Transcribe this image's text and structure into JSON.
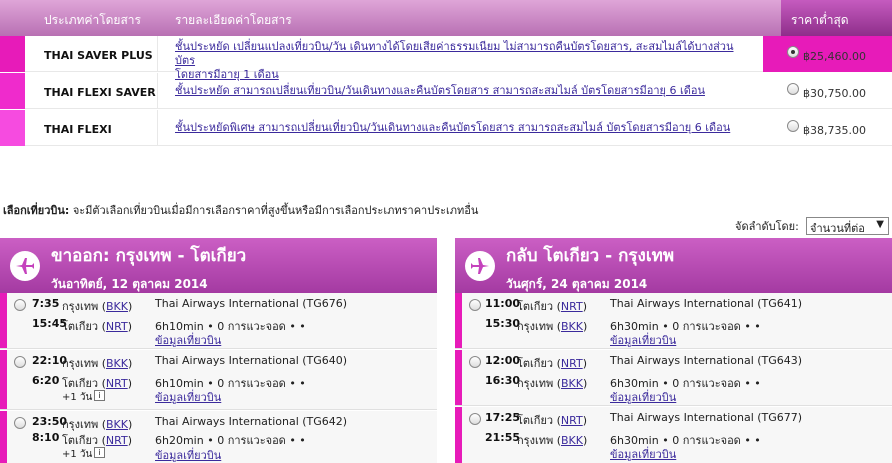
{
  "fare_table": {
    "header": {
      "type_label": "ประเภทค่าโดยสาร",
      "detail_label": "รายละเอียดค่าโดยสาร",
      "price_label": "ราคาต่ำสุด"
    },
    "rows": [
      {
        "name": "THAI SAVER PLUS",
        "desc_line1": "ชั้นประหยัด เปลี่ยนแปลงเที่ยวบิน/วัน เดินทางได้โดยเสียค่าธรรมเนียม ไม่สามารถคืนบัตรโดยสาร, สะสมไมล์ได้บางส่วน บัตร",
        "desc_line2": "โดยสารมีอายุ 1 เดือน",
        "price": "฿25,460.00",
        "selected": true,
        "bar_color": "#e71bb9"
      },
      {
        "name": "THAI FLEXI SAVER",
        "desc_line1": "ชั้นประหยัด สามารถเปลี่ยนเที่ยวบิน/วันเดินทางและคืนบัตรโดยสาร สามารถสะสมไมล์ บัตรโดยสารมีอายุ 6 เดือน",
        "desc_line2": "",
        "price": "฿30,750.00",
        "selected": false,
        "bar_color": "#ef2bcc"
      },
      {
        "name": "THAI FLEXI",
        "desc_line1": "ชั้นประหยัดพิเศษ สามารถเปลี่ยนเที่ยวบิน/วันเดินทางและคืนบัตรโดยสาร สามารถสะสมไมล์ บัตรโดยสารมีอายุ 6 เดือน",
        "desc_line2": "",
        "price": "฿38,735.00",
        "selected": false,
        "bar_color": "#f64be0"
      }
    ]
  },
  "select_flight": {
    "label": "เลือกเที่ยวบิน:",
    "note": "จะมีตัวเลือกเที่ยวบินเมื่อมีการเลือกราคาที่สูงขึ้นหรือมีการเลือกประเภทราคาประเภทอื่น",
    "sort_label": "จัดลำดับโดย:",
    "sort_value": "จำนวนที่ต่อ"
  },
  "outbound": {
    "title": "ขาออก: กรุงเทพ - โตเกียว",
    "date": "วันอาทิตย์, 12 ตุลาคม 2014",
    "flights": [
      {
        "dep_time": "7:35",
        "dep_city": "กรุงเทพ",
        "dep_code": "BKK",
        "arr_time": "15:45",
        "arr_city": "โตเกียว",
        "arr_code": "NRT",
        "airline": "Thai Airways International (TG676)",
        "duration": "6h10min",
        "stops": "0 การแวะจอด",
        "detail": "ข้อมูลเที่ยวบิน",
        "plus_day": ""
      },
      {
        "dep_time": "22:10",
        "dep_city": "กรุงเทพ",
        "dep_code": "BKK",
        "arr_time": "6:20",
        "arr_city": "โตเกียว",
        "arr_code": "NRT",
        "airline": "Thai Airways International (TG640)",
        "duration": "6h10min",
        "stops": "0 การแวะจอด",
        "detail": "ข้อมูลเที่ยวบิน",
        "plus_day": "+1 วัน"
      },
      {
        "dep_time": "23:50",
        "dep_city": "กรุงเทพ",
        "dep_code": "BKK",
        "arr_time": "8:10",
        "arr_city": "โตเกียว",
        "arr_code": "NRT",
        "airline": "Thai Airways International (TG642)",
        "duration": "6h20min",
        "stops": "0 การแวะจอด",
        "detail": "ข้อมูลเที่ยวบิน",
        "plus_day": "+1 วัน"
      }
    ]
  },
  "return": {
    "title": "กลับ โตเกียว - กรุงเทพ",
    "date": "วันศุกร์, 24 ตุลาคม 2014",
    "flights": [
      {
        "dep_time": "11:00",
        "dep_city": "โตเกียว",
        "dep_code": "NRT",
        "arr_time": "15:30",
        "arr_city": "กรุงเทพ",
        "arr_code": "BKK",
        "airline": "Thai Airways International (TG641)",
        "duration": "6h30min",
        "stops": "0 การแวะจอด",
        "detail": "ข้อมูลเที่ยวบิน",
        "plus_day": ""
      },
      {
        "dep_time": "12:00",
        "dep_city": "โตเกียว",
        "dep_code": "NRT",
        "arr_time": "16:30",
        "arr_city": "กรุงเทพ",
        "arr_code": "BKK",
        "airline": "Thai Airways International (TG643)",
        "duration": "6h30min",
        "stops": "0 การแวะจอด",
        "detail": "ข้อมูลเที่ยวบิน",
        "plus_day": ""
      },
      {
        "dep_time": "17:25",
        "dep_city": "โตเกียว",
        "dep_code": "NRT",
        "arr_time": "21:55",
        "arr_city": "กรุงเทพ",
        "arr_code": "BKK",
        "airline": "Thai Airways International (TG677)",
        "duration": "6h30min",
        "stops": "0 การแวะจอด",
        "detail": "ข้อมูลเที่ยวบิน",
        "plus_day": ""
      }
    ]
  },
  "icons": {
    "plane": "airplane-icon",
    "info": "info-icon",
    "dropdown": "chevron-down-icon"
  },
  "colors": {
    "accent": "#e71bb9",
    "header_purple": "#b870b3",
    "link": "#3b2a9c"
  }
}
